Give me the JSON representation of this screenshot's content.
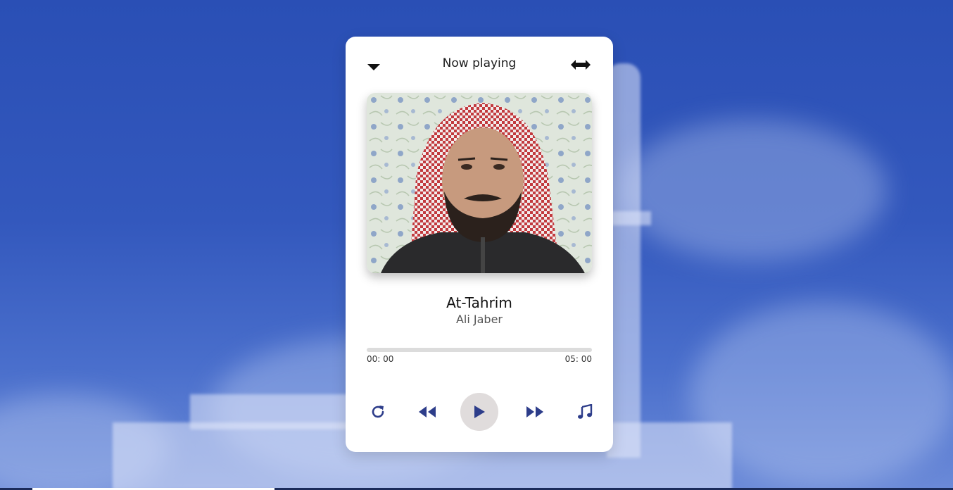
{
  "header": {
    "title": "Now playing",
    "collapse_icon": "caret-down-icon",
    "expand_icon": "arrows-horizontal-icon"
  },
  "track": {
    "title": "At-Tahrim",
    "artist": "Ali Jaber",
    "artwork": "portrait of a man in red-and-white keffiyeh"
  },
  "progress": {
    "current": "00: 00",
    "total": "05: 00",
    "fraction": 0
  },
  "controls": {
    "repeat_icon": "repeat-icon",
    "rewind_icon": "rewind-icon",
    "play_icon": "play-icon",
    "forward_icon": "fast-forward-icon",
    "playlist_icon": "music-note-icon"
  },
  "colors": {
    "accent": "#2d3d8a",
    "background": "#2a4fb5",
    "play_button_bg": "#e0dcdc"
  }
}
